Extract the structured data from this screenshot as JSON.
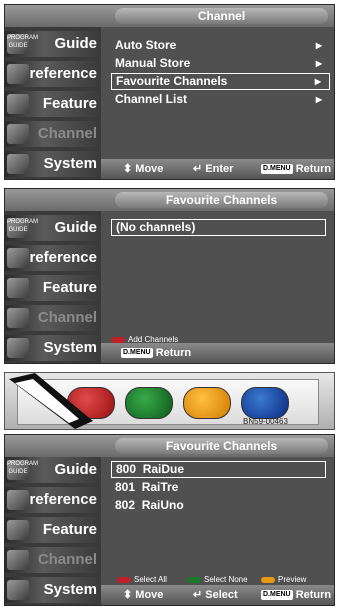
{
  "screen1": {
    "title": "Channel",
    "items": [
      {
        "label": "Auto Store"
      },
      {
        "label": "Manual Store"
      },
      {
        "label": "Favourite Channels"
      },
      {
        "label": "Channel List"
      }
    ],
    "hints": {
      "move": "Move",
      "enter": "Enter",
      "dmenu": "D.MENU",
      "return": "Return"
    }
  },
  "screen2": {
    "title": "Favourite Channels",
    "box_text": "(No channels)",
    "legend": {
      "add": "Add Channels"
    },
    "hints": {
      "dmenu": "D.MENU",
      "return": "Return"
    }
  },
  "remote": {
    "model": "BN59-00463"
  },
  "screen3": {
    "title": "Favourite Channels",
    "channels": [
      {
        "number": "800",
        "name": "RaiDue"
      },
      {
        "number": "801",
        "name": "RaiTre"
      },
      {
        "number": "802",
        "name": "RaiUno"
      }
    ],
    "legend": {
      "select_all": "Select All",
      "select_none": "Select None",
      "preview": "Preview"
    },
    "hints": {
      "move": "Move",
      "select": "Select",
      "dmenu": "D.MENU",
      "return": "Return"
    }
  },
  "sidebar": {
    "icon_label": "PROGRAM GUIDE",
    "items": [
      {
        "label": "Guide",
        "dim": false
      },
      {
        "label": "Preference",
        "dim": false
      },
      {
        "label": "Feature",
        "dim": false
      },
      {
        "label": "Channel",
        "dim": true
      },
      {
        "label": "System",
        "dim": false
      }
    ]
  },
  "colors": {
    "red": "#c0202a",
    "green": "#1a7a2a",
    "yellow": "#e89a10",
    "blue": "#1a4aa0"
  }
}
